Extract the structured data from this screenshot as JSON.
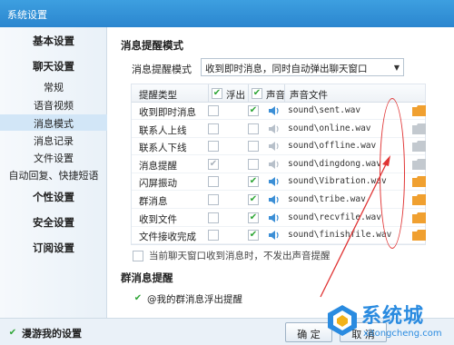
{
  "window": {
    "title": "系统设置"
  },
  "sidebar": {
    "items": [
      {
        "label": "基本设置",
        "type": "main"
      },
      {
        "label": "聊天设置",
        "type": "main"
      },
      {
        "label": "常规",
        "type": "sub"
      },
      {
        "label": "语音视频",
        "type": "sub"
      },
      {
        "label": "消息模式",
        "type": "sub",
        "active": true
      },
      {
        "label": "消息记录",
        "type": "sub"
      },
      {
        "label": "文件设置",
        "type": "sub"
      },
      {
        "label": "自动回复、快捷短语",
        "type": "sub"
      },
      {
        "label": "个性设置",
        "type": "main"
      },
      {
        "label": "安全设置",
        "type": "main"
      },
      {
        "label": "订阅设置",
        "type": "main"
      }
    ]
  },
  "main": {
    "section_title": "消息提醒模式",
    "mode": {
      "label": "消息提醒模式",
      "value": "收到即时消息，同时自动弹出聊天窗口"
    },
    "table": {
      "headers": {
        "type": "提醒类型",
        "popup": "浮出",
        "sound": "声音",
        "file": "声音文件"
      },
      "rows": [
        {
          "name": "收到即时消息",
          "popup": false,
          "sound": true,
          "file": "sound\\sent.wav"
        },
        {
          "name": "联系人上线",
          "popup": false,
          "sound": false,
          "file": "sound\\online.wav"
        },
        {
          "name": "联系人下线",
          "popup": false,
          "sound": false,
          "file": "sound\\offline.wav"
        },
        {
          "name": "消息提醒",
          "popup": true,
          "sound": false,
          "file": "sound\\dingdong.wav"
        },
        {
          "name": "闪屏振动",
          "popup": false,
          "sound": true,
          "file": "sound\\Vibration.wav"
        },
        {
          "name": "群消息",
          "popup": false,
          "sound": true,
          "file": "sound\\tribe.wav"
        },
        {
          "name": "收到文件",
          "popup": false,
          "sound": true,
          "file": "sound\\recvfile.wav"
        },
        {
          "name": "文件接收完成",
          "popup": false,
          "sound": true,
          "file": "sound\\finishfile.wav"
        }
      ]
    },
    "mute_note": "当前聊天窗口收到消息时，不发出声音提醒",
    "group_title": "群消息提醒",
    "group_option": "@我的群消息浮出提醒"
  },
  "footer": {
    "roaming_label": "漫游我的设置",
    "ok_label": "确 定",
    "cancel_label": "取 消"
  },
  "watermark": {
    "text": "系统城",
    "sub": "xitongcheng.com"
  },
  "colors": {
    "title_bar": "#2b86cf",
    "check": "#2fa637",
    "highlight": "#e03434",
    "folder": "#f0a030"
  }
}
